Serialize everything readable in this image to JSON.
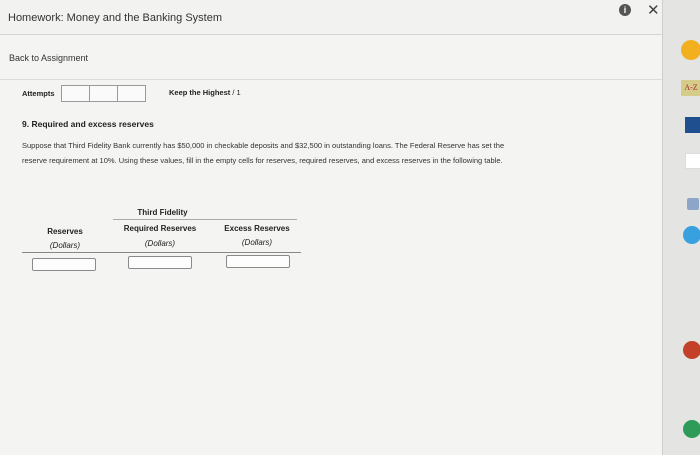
{
  "window": {
    "title": "Homework: Money and the Banking System"
  },
  "nav": {
    "back_label": "Back to Assignment"
  },
  "attempts": {
    "label": "Attempts",
    "keep_label": "Keep the Highest",
    "score": "/ 1"
  },
  "question": {
    "title": "9. Required and excess reserves",
    "line1": "Suppose that Third Fidelity Bank currently has $50,000 in checkable deposits and $32,500 in outstanding loans. The Federal Reserve has set the",
    "line2": "reserve requirement at 10%. Using these values, fill in the empty cells for reserves, required reserves, and excess reserves in the following table."
  },
  "table": {
    "bank_name": "Third Fidelity",
    "columns": [
      {
        "header": "Reserves",
        "unit": "(Dollars)",
        "value": ""
      },
      {
        "header": "Required Reserves",
        "unit": "(Dollars)",
        "value": ""
      },
      {
        "header": "Excess Reserves",
        "unit": "(Dollars)",
        "value": ""
      }
    ]
  },
  "sidebar": {
    "icons": [
      "rss-icon",
      "a-z-icon",
      "blue-block-icon",
      "note-icon",
      "bookmark-icon",
      "blue-circle-icon",
      "red-icon",
      "green-icon"
    ],
    "az_label": "A-Z"
  }
}
